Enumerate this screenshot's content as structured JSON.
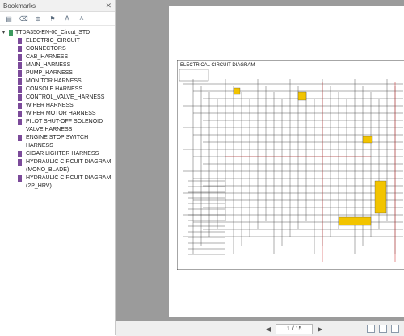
{
  "sidebar": {
    "title": "Bookmarks",
    "close_icon": "close-icon",
    "toolbar": [
      "options-menu-icon",
      "delete-bookmark-icon",
      "add-bookmark-icon",
      "bookmark-tag-icon",
      "font-larger-icon",
      "font-smaller-icon"
    ],
    "toolbar_glyphs": [
      "▤",
      "⌫",
      "⊕",
      "⚑",
      "A",
      "A"
    ],
    "root": "TTDA350-EN-00_Circut_STD",
    "items": [
      "ELECTRIC_CIRCUIT",
      "CONNECTORS",
      "CAB_HARNESS",
      "MAIN_HARNESS",
      "PUMP_HARNESS",
      "MONITOR HARNESS",
      "CONSOLE HARNESS",
      "CONTROL_VALVE_HARNESS",
      "WIPER HARNESS",
      "WIPER MOTOR HARNESS",
      "PILOT SHUT-OFF SOLENOID\nVALVE HARNESS",
      "ENGINE STOP SWITCH HARNESS",
      "CIGAR LIGHTER HARNESS",
      "HYDRAULIC CIRCUIT DIAGRAM\n(MONO_BLADE)",
      "HYDRAULIC CIRCUIT DIAGRAM\n(2P_HRV)"
    ]
  },
  "document": {
    "diagram_title": "ELECTRICAL CIRCUIT DIAGRAM"
  },
  "statusbar": {
    "current_page": "1",
    "total_pages": "/ 15"
  },
  "colors": {
    "accent_yellow": "#f2c400",
    "wire_red": "#cc2222",
    "bookmark_purple": "#7b4a9a",
    "root_green": "#3c9a5f"
  }
}
